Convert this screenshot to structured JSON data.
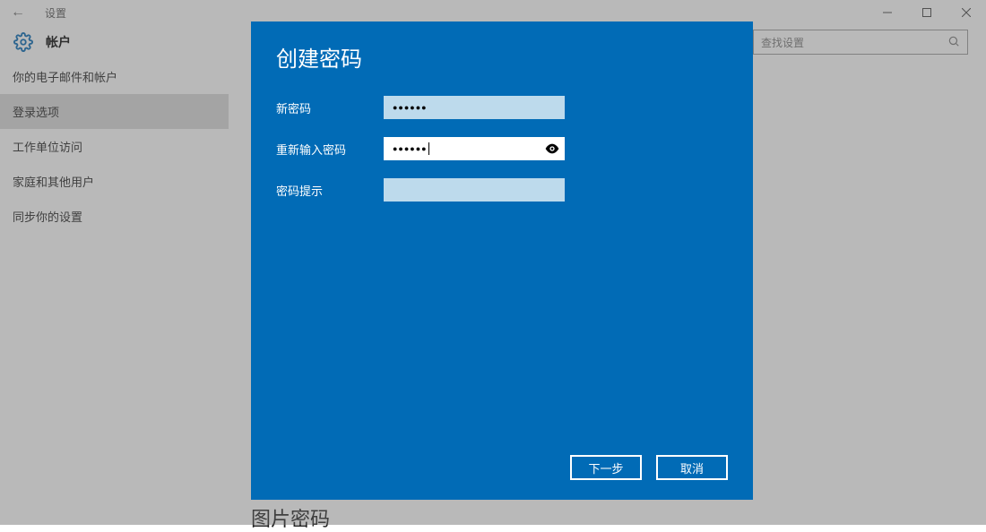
{
  "titlebar": {
    "app_name": "设置"
  },
  "header": {
    "title": "帐户",
    "search_placeholder": "查找设置"
  },
  "sidebar": {
    "items": [
      {
        "label": "你的电子邮件和帐户",
        "selected": false
      },
      {
        "label": "登录选项",
        "selected": true
      },
      {
        "label": "工作单位访问",
        "selected": false
      },
      {
        "label": "家庭和其他用户",
        "selected": false
      },
      {
        "label": "同步你的设置",
        "selected": false
      }
    ]
  },
  "main": {
    "section_heading": "图片密码"
  },
  "modal": {
    "title": "创建密码",
    "fields": {
      "new_password": {
        "label": "新密码",
        "value_mask": "●●●●●●"
      },
      "confirm_password": {
        "label": "重新输入密码",
        "value_mask": "●●●●●●"
      },
      "password_hint": {
        "label": "密码提示",
        "value": ""
      }
    },
    "buttons": {
      "next": "下一步",
      "cancel": "取消"
    }
  }
}
